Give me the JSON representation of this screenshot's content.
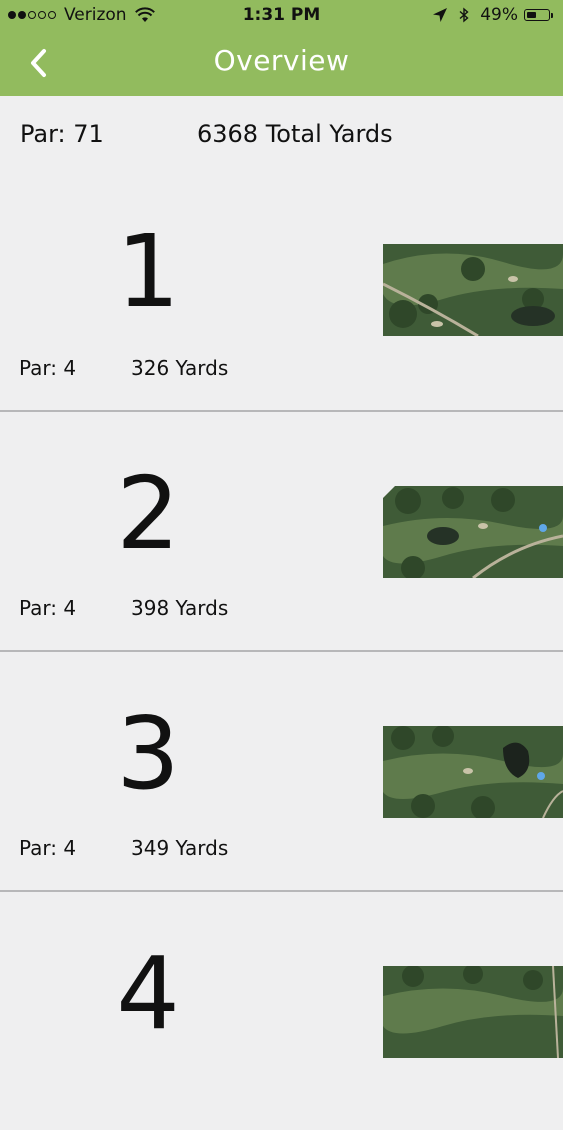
{
  "status_bar": {
    "carrier": "Verizon",
    "time": "1:31 PM",
    "battery": "49%",
    "signal_bars_filled": 2,
    "signal_bars_total": 5,
    "battery_level": 0.49
  },
  "nav": {
    "title": "Overview",
    "back_icon": "chevron-left-icon"
  },
  "summary": {
    "par": "Par: 71",
    "total_yards": "6368 Total Yards"
  },
  "holes": [
    {
      "number": "1",
      "par": "Par: 4",
      "yards": "326 Yards"
    },
    {
      "number": "2",
      "par": "Par: 4",
      "yards": "398 Yards"
    },
    {
      "number": "3",
      "par": "Par: 4",
      "yards": "349 Yards"
    },
    {
      "number": "4",
      "par": "",
      "yards": ""
    }
  ],
  "colors": {
    "header_green": "#92bb5e",
    "background": "#efeff0",
    "divider": "#b7b7b9"
  }
}
